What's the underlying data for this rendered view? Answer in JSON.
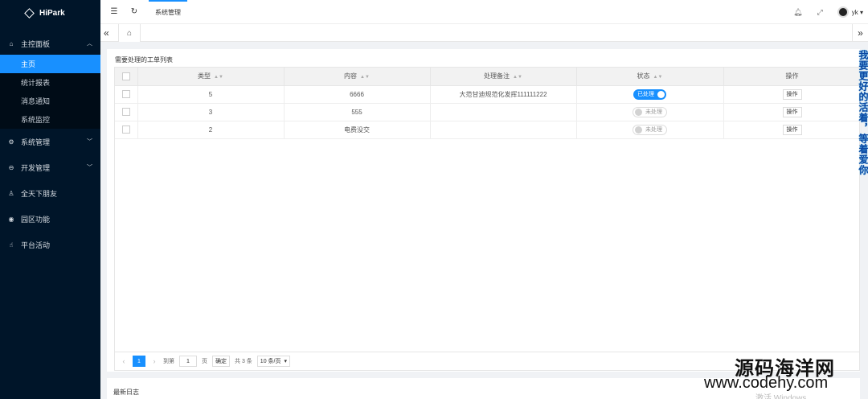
{
  "app": {
    "name": "HiPark"
  },
  "sidebar": {
    "groups": [
      {
        "label": "主控面板",
        "icon": "home-icon",
        "expanded": true,
        "items": [
          {
            "label": "主页",
            "active": true
          },
          {
            "label": "统计报表",
            "active": false
          },
          {
            "label": "消息通知",
            "active": false
          },
          {
            "label": "系统监控",
            "active": false
          }
        ]
      },
      {
        "label": "系统管理",
        "icon": "gear-icon",
        "expanded": false
      },
      {
        "label": "开发管理",
        "icon": "code-icon",
        "expanded": false
      },
      {
        "label": "全天下朋友",
        "icon": "user-icon",
        "expanded": false
      },
      {
        "label": "园区功能",
        "icon": "compass-icon",
        "expanded": false
      },
      {
        "label": "平台活动",
        "icon": "hand-icon",
        "expanded": false
      }
    ]
  },
  "header": {
    "active_tab": "系统管理",
    "username": "yk",
    "icons": [
      "menu-fold-icon",
      "refresh-icon",
      "bell-icon",
      "fullscreen-icon",
      "avatar"
    ]
  },
  "tabbar": {
    "home_icon": "home-icon"
  },
  "worklist": {
    "title": "需要处理的工单列表",
    "columns": [
      "类型",
      "内容",
      "处理备注",
      "状态",
      "操作"
    ],
    "rows": [
      {
        "type": "5",
        "content": "6666",
        "remark": "大范甘迪规范化发挥111111222",
        "status": "已处理",
        "status_on": true,
        "action": "操作"
      },
      {
        "type": "3",
        "content": "555",
        "remark": "",
        "status": "未处理",
        "status_on": false,
        "action": "操作"
      },
      {
        "type": "2",
        "content": "电费没交",
        "remark": "",
        "status": "未处理",
        "status_on": false,
        "action": "操作"
      }
    ],
    "pagination": {
      "current": "1",
      "goto_label": "到第",
      "goto_value": "1",
      "page_unit": "页",
      "confirm": "确定",
      "total": "共 3 条",
      "page_size": "10 条/页"
    }
  },
  "bottom_card": {
    "title": "最新日志"
  },
  "side_notice": "我要更好的活着，等着爱你",
  "watermark": {
    "line1": "源码海洋网",
    "line2": "www.codehy.com",
    "line3": "激活 Windows"
  },
  "colors": {
    "sidebar_bg": "#001529",
    "accent": "#1890ff"
  }
}
